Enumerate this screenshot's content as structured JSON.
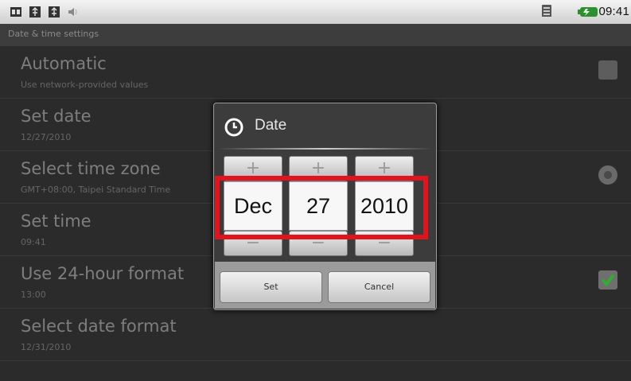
{
  "status_bar": {
    "time": "09:41",
    "left_icons": [
      "notification-app-icon",
      "usb-icon",
      "usb-debug-icon",
      "volume-icon"
    ],
    "right_icons": [
      "sd-card-icon",
      "battery-charging-icon"
    ]
  },
  "header": {
    "title": "Date & time settings"
  },
  "settings": [
    {
      "title": "Automatic",
      "subtitle": "Use network-provided values",
      "control": "checkbox",
      "checked": false
    },
    {
      "title": "Set date",
      "subtitle": "12/27/2010"
    },
    {
      "title": "Select time zone",
      "subtitle": "GMT+08:00, Taipei Standard Time",
      "control": "radio"
    },
    {
      "title": "Set time",
      "subtitle": "09:41"
    },
    {
      "title": "Use 24-hour format",
      "subtitle": "13:00",
      "control": "checkbox",
      "checked": true
    },
    {
      "title": "Select date format",
      "subtitle": "12/31/2010"
    }
  ],
  "dialog": {
    "title": "Date",
    "month": "Dec",
    "day": "27",
    "year": "2010",
    "increment_symbol": "+",
    "decrement_symbol": "−",
    "set_label": "Set",
    "cancel_label": "Cancel"
  },
  "colors": {
    "highlight": "#e0141c",
    "check_green": "#2fae2f"
  }
}
